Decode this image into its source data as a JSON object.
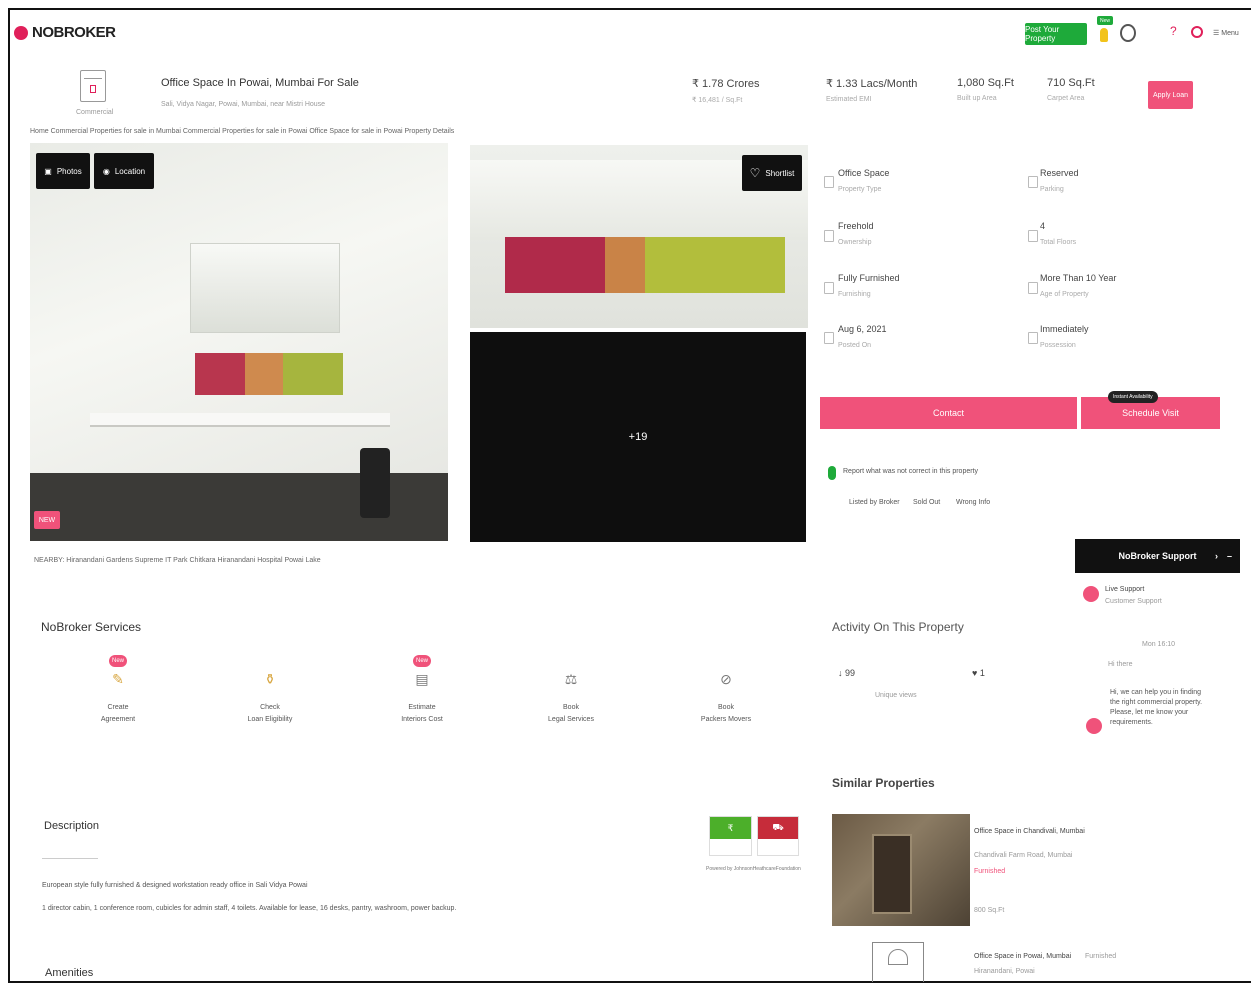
{
  "header": {
    "logo_text": "NOBROKER",
    "search_hint": "",
    "post_button": "Post Your Property",
    "new_badge": "New",
    "menu_label": "Menu"
  },
  "property": {
    "type_label": "Commercial",
    "title": "Office Space In Powai, Mumbai For Sale",
    "address": "Sali, Vidya Nagar, Powai, Mumbai, near Mistri House",
    "breadcrumb": "Home  Commercial Properties for sale in Mumbai  Commercial Properties for sale in Powai  Office Space for sale in Powai  Property Details",
    "stats": [
      {
        "value": "₹ 1.78 Crores",
        "label": "₹ 16,481 / Sq.Ft"
      },
      {
        "value": "₹ 1.33 Lacs/Month",
        "label": "Estimated EMI"
      },
      {
        "value": "1,080 Sq.Ft",
        "label": "Built up Area"
      },
      {
        "value": "710 Sq.Ft",
        "label": "Carpet Area"
      }
    ],
    "apply_loan": "Apply Loan"
  },
  "gallery": {
    "photos_btn": "Photos",
    "location_btn": "Location",
    "shortlist_btn": "Shortlist",
    "more_photos": "+19",
    "new_badge": "NEW",
    "nearby": "NEARBY:  Hiranandani Gardens   Supreme IT Park   Chitkara   Hiranandani Hospital   Powai Lake"
  },
  "details": [
    {
      "value": "Office Space",
      "sub": "Property Type"
    },
    {
      "value": "Reserved",
      "sub": "Parking"
    },
    {
      "value": "Freehold",
      "sub": "Ownership"
    },
    {
      "value": "4",
      "sub": "Total Floors"
    },
    {
      "value": "Fully Furnished",
      "sub": "Furnishing"
    },
    {
      "value": "More Than 10 Year",
      "sub": "Age of Property"
    },
    {
      "value": "Aug 6, 2021",
      "sub": "Posted On"
    },
    {
      "value": "Immediately",
      "sub": "Possession"
    }
  ],
  "actions": {
    "contact": "Contact",
    "schedule": "Schedule Visit",
    "instant_tag": "Instant Availability"
  },
  "report": {
    "text": "Report what was not correct in this property",
    "options": [
      "Listed by Broker",
      "Sold Out",
      "Wrong Info"
    ]
  },
  "support": {
    "title": "NoBroker Support",
    "agent_name": "Live Support",
    "agent_role": "Customer Support",
    "date": "Mon 16:10",
    "chat_label": "Hi there",
    "message": "Hi, we can help you in finding the right commercial property. Please, let me know your requirements."
  },
  "services": {
    "title": "NoBroker Services",
    "items": [
      {
        "label": "Create",
        "label2": "Agreement",
        "badge": "New"
      },
      {
        "label": "Check",
        "label2": "Loan Eligibility",
        "badge": ""
      },
      {
        "label": "Estimate",
        "label2": "Interiors Cost",
        "badge": "New"
      },
      {
        "label": "Book",
        "label2": "Legal Services",
        "badge": ""
      },
      {
        "label": "Book",
        "label2": "Packers Movers",
        "badge": ""
      }
    ]
  },
  "activity": {
    "title": "Activity On This Property",
    "views": "99",
    "views_label": "Unique views",
    "likes": "1"
  },
  "description": {
    "title": "Description",
    "line1": "European style fully furnished & designed workstation ready office in Sali Vidya Powai",
    "line2": "1 director cabin, 1 conference room, cubicles for admin staff, 4 toilets. Available for lease, 16 desks, pantry, washroom, power backup.",
    "powered_by": "Powered by JohnsonHeathcareFoundation"
  },
  "amenities": {
    "title": "Amenities"
  },
  "similar": {
    "title": "Similar Properties",
    "items": [
      {
        "name": "Office Space in Chandivali, Mumbai",
        "detail": "Chandivali Farm Road, Mumbai",
        "tag": "Furnished",
        "size": "800 Sq.Ft"
      },
      {
        "name": "Office Space in Powai, Mumbai",
        "detail": "Hiranandani, Powai",
        "tag": "Furnished",
        "size": ""
      }
    ]
  },
  "colors": {
    "brand": "#e0205a",
    "accent_pink": "#f0527a",
    "green": "#1eaa3a",
    "dark": "#111111"
  }
}
